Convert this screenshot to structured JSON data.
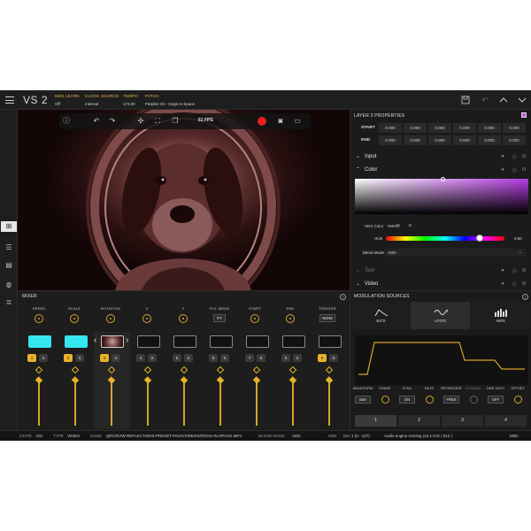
{
  "app": {
    "title": "VS 2"
  },
  "topbar": {
    "midi_learn_label": "MIDI LEARN",
    "midi_learn_value": "Off",
    "clock_source_label": "CLOCK SOURCE",
    "clock_source_value": "Internal",
    "tempo_label": "TEMPO",
    "tempo_value": "173.00",
    "patch_label": "PATCH",
    "patch_value": "Perplex On - Dogs In Space"
  },
  "viewer": {
    "fps": "61 FPS"
  },
  "layer_properties": {
    "title": "LAYER 3 PROPERTIES",
    "start_label": "START",
    "end_label": "END",
    "start_values": [
      "0.000",
      "0.000",
      "0.000",
      "0.000",
      "0.000",
      "0.000"
    ],
    "end_values": [
      "0.000",
      "0.000",
      "0.000",
      "0.000",
      "0.000",
      "0.000"
    ],
    "sections": {
      "input": "Input",
      "color": "Color",
      "text": "Text",
      "video": "Video"
    },
    "hex_label": "HEX Color",
    "hex_value": "#e57fff",
    "hue_label": "HUE",
    "hue_value": "0.80",
    "blend_label": "Blend Mode",
    "blend_value": "ADD"
  },
  "mixer": {
    "title": "MIXER",
    "knobs": [
      "SPEED",
      "SCALE",
      "ROTATION",
      "X",
      "Y",
      "FILL MODE",
      "START",
      "END",
      "TRIGGER"
    ],
    "fill_mode_value": "FIT",
    "trigger_value": "NONE",
    "channels": [
      {
        "num": "1",
        "solo": "S",
        "active": true
      },
      {
        "num": "2",
        "solo": "S",
        "active": true
      },
      {
        "num": "3",
        "solo": "S",
        "active": true
      },
      {
        "num": "4",
        "solo": "S",
        "active": false
      },
      {
        "num": "5",
        "solo": "S",
        "active": false
      },
      {
        "num": "6",
        "solo": "S",
        "active": false
      },
      {
        "num": "7",
        "solo": "S",
        "active": false
      },
      {
        "num": "8",
        "solo": "S",
        "active": false
      },
      {
        "num": "9",
        "solo": "S",
        "active": true
      }
    ]
  },
  "modulation": {
    "title": "MODULATION SOURCES",
    "tabs": [
      "EG'S",
      "LFO'S",
      "AM'S"
    ],
    "params": [
      {
        "label": "WAVEFORM",
        "value": "S&H"
      },
      {
        "label": "PHASE",
        "value": ""
      },
      {
        "label": "SYNC",
        "value": "ON"
      },
      {
        "label": "RATE",
        "value": ""
      },
      {
        "label": "RETRIGGER",
        "value": "FREE"
      },
      {
        "label": "CHANNEL",
        "value": ""
      },
      {
        "label": "ONE SHOT",
        "value": "OFF"
      },
      {
        "label": "OFFSET",
        "value": ""
      }
    ],
    "steps": [
      "1",
      "2",
      "3",
      "4"
    ]
  },
  "status": {
    "state_label": "STATE",
    "state_value": "ON",
    "type_label": "TYPE",
    "type_value": "VIDEO",
    "name_label": "NAME",
    "name_value": "QRC/RAW-REFLECTIONS-PRESET-PACK/VIDEOS/DOGS-IN-SPACE.MP4",
    "blend_label": "BLEND MODE",
    "blend_value": "ADD",
    "midi_label": "MIDI",
    "channel_text": "CH: 1  (0 - 127)",
    "audio_text": "Audio engine running (44.1 kHz / 512 )",
    "midi_right": "MIDI"
  },
  "colors": {
    "accent": "#e8b128",
    "cyan": "#35e6f0",
    "record": "#e2201f",
    "picker": "#b43be0"
  }
}
